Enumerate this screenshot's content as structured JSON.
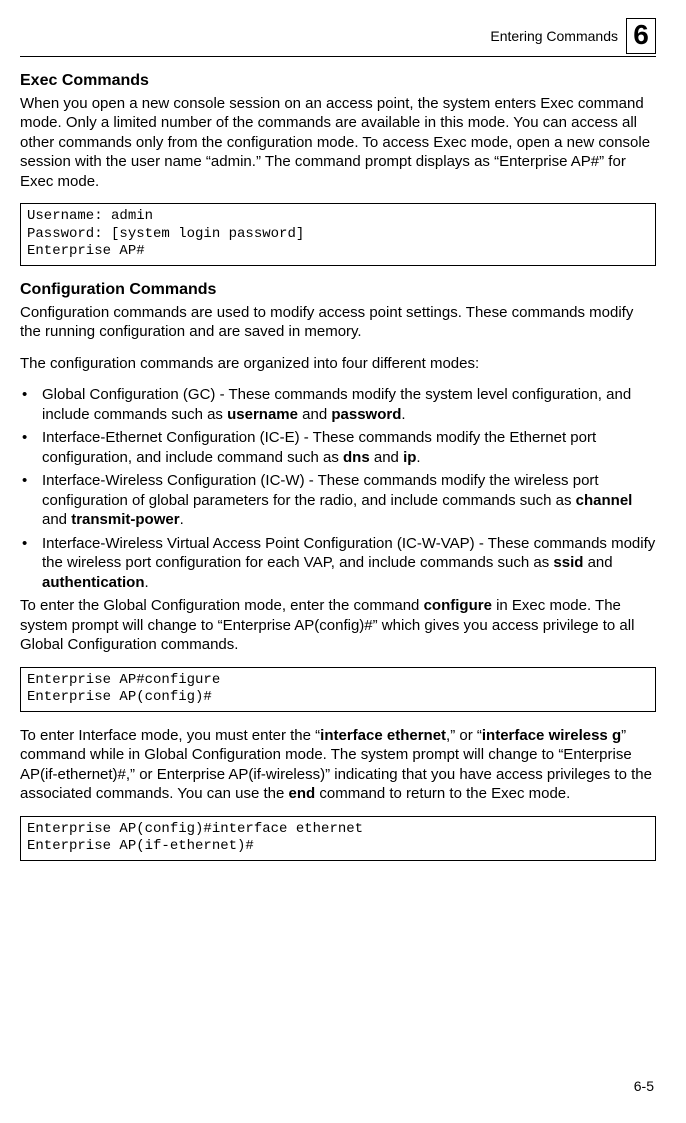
{
  "header": {
    "section_label": "Entering Commands",
    "chapter_number": "6"
  },
  "sections": {
    "exec": {
      "title": "Exec Commands",
      "p1": "When you open a new console session on an access point, the system enters Exec command mode. Only a limited number of the commands are available in this mode. You can access all other commands only from the configuration mode. To access Exec mode, open a new console session with the user name “admin.” The command prompt displays as “Enterprise AP#” for Exec mode.",
      "code": "Username: admin\nPassword: [system login password]\nEnterprise AP#"
    },
    "config": {
      "title": "Configuration Commands",
      "p1": "Configuration commands are used to modify access point settings. These commands modify the running configuration and are saved in memory.",
      "p2": "The configuration commands are organized into four different modes:",
      "bullets": {
        "b1_pre": "Global Configuration (GC) - These commands modify the system level configuration, and include commands such as ",
        "b1_bold1": "username",
        "b1_mid": " and ",
        "b1_bold2": "password",
        "b1_post": ".",
        "b2_pre": "Interface-Ethernet Configuration (IC-E) - These commands modify the Ethernet port configuration, and include command such as ",
        "b2_bold1": "dns",
        "b2_mid": " and ",
        "b2_bold2": "ip",
        "b2_post": ".",
        "b3_pre": "Interface-Wireless Configuration (IC-W) - These commands modify the wireless port configuration of global parameters for the radio, and include commands such as ",
        "b3_bold1": "channel",
        "b3_mid": " and ",
        "b3_bold2": "transmit-power",
        "b3_post": ".",
        "b4_pre": "Interface-Wireless Virtual Access Point Configuration (IC-W-VAP) - These commands modify the wireless port configuration for each VAP, and include commands such as ",
        "b4_bold1": "ssid",
        "b4_mid": " and ",
        "b4_bold2": "authentication",
        "b4_post": "."
      },
      "p3_pre": "To enter the Global Configuration mode, enter the command ",
      "p3_bold": "configure",
      "p3_post": " in Exec mode. The system prompt will change to “Enterprise AP(config)#” which gives you access privilege to all Global Configuration commands.",
      "code2": "Enterprise AP#configure\nEnterprise AP(config)#",
      "p4_a": "To enter Interface mode, you must enter the “",
      "p4_bold1": "interface ethernet",
      "p4_b": ",” or “",
      "p4_bold2": "interface wireless g",
      "p4_c": "” command while in Global Configuration mode. The system prompt will change to “Enterprise AP(if-ethernet)#,” or Enterprise AP(if-wireless)” indicating that you have access privileges to the associated commands. You can use the ",
      "p4_bold3": "end",
      "p4_d": " command to return to the Exec mode.",
      "code3": "Enterprise AP(config)#interface ethernet\nEnterprise AP(if-ethernet)#"
    }
  },
  "footer": {
    "page_number": "6-5"
  }
}
